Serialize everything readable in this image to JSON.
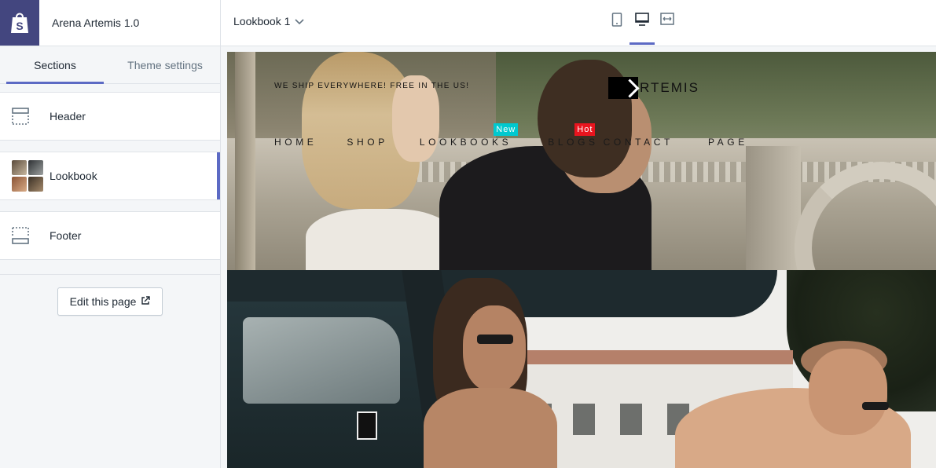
{
  "app": {
    "logo_icon": "shopify-bag-icon",
    "title": "Arena Artemis 1.0",
    "accent_color": "#5c6ac4",
    "logo_bg_color": "#43467f"
  },
  "tabs": [
    {
      "label": "Sections",
      "active": true
    },
    {
      "label": "Theme settings",
      "active": false
    }
  ],
  "sections": [
    {
      "label": "Header",
      "icon": "header-layout-icon",
      "selected": false
    },
    {
      "label": "Lookbook",
      "icon": "lookbook-thumbnail",
      "selected": true
    },
    {
      "label": "Footer",
      "icon": "footer-layout-icon",
      "selected": false
    }
  ],
  "edit_page": {
    "label": "Edit this page",
    "icon": "external-link-icon"
  },
  "topbar": {
    "page_select": "Lookbook 1",
    "page_select_icon": "chevron-down-icon",
    "views": [
      {
        "name": "mobile-view",
        "icon": "mobile-icon",
        "active": false
      },
      {
        "name": "desktop-view",
        "icon": "desktop-icon",
        "active": true
      },
      {
        "name": "full-width-view",
        "icon": "fullscreen-icon",
        "active": false
      }
    ]
  },
  "preview": {
    "announcement": "WE SHIP EVERYWHERE! FREE IN THE US!",
    "logo_text": "RTEMIS",
    "nav": [
      {
        "label": "HOME",
        "badge": null
      },
      {
        "label": "SHOP",
        "badge": null
      },
      {
        "label": "LOOKBOOKS",
        "badge": "New",
        "badge_color": "#00c9cf"
      },
      {
        "label": "BLOGS",
        "badge": "Hot",
        "badge_color": "#e8141e"
      },
      {
        "label": "CONTACT",
        "badge": null
      },
      {
        "label": "PAGE",
        "badge": null
      }
    ]
  }
}
